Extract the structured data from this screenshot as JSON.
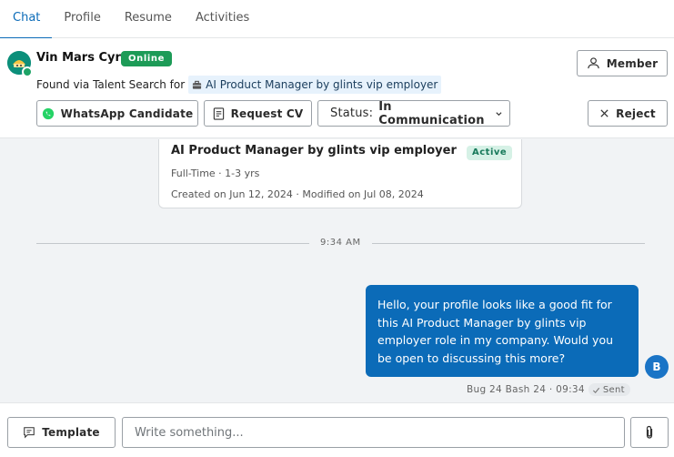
{
  "tabs": [
    {
      "label": "Chat"
    },
    {
      "label": "Profile"
    },
    {
      "label": "Resume"
    },
    {
      "label": "Activities"
    }
  ],
  "candidate": {
    "name": "Vin Mars Cyrr",
    "online_label": "Online",
    "found_via": "Found via Talent Search for",
    "job_title": "AI Product Manager by glints vip employer"
  },
  "actions": {
    "member": "Member",
    "whatsapp": "WhatsApp Candidate",
    "request_cv": "Request CV",
    "status_label": "Status:",
    "status_value": "In Communication",
    "reject": "Reject"
  },
  "job_card": {
    "title": "AI Product Manager by glints vip employer",
    "badge": "Active",
    "meta": "Full-Time · 1-3 yrs",
    "dates": "Created on Jun 12, 2024 · Modified on Jul 08, 2024"
  },
  "chat": {
    "divider_time": "9:34 AM",
    "message": {
      "text": "Hello, your profile looks like a good fit for this AI Product Manager by glints vip employer role in my company. Would you be open to discussing this more?",
      "sender_initial": "B",
      "sender_meta": "Bug 24 Bash 24 · 09:34",
      "status": "Sent"
    }
  },
  "footer": {
    "template": "Template",
    "compose_placeholder": "Write something..."
  },
  "colors": {
    "accent": "#0b6bb8",
    "online": "#1d9b57",
    "active_badge_bg": "#d6f1e6",
    "active_badge_text": "#17795a",
    "chip_bg": "#e7f2fc",
    "chat_bg": "#f1f3f5"
  },
  "icons": {
    "member": "user-icon",
    "whatsapp": "whatsapp-icon",
    "request_cv": "document-icon",
    "status": "chevron-down-icon",
    "reject": "close-icon",
    "template": "message-template-icon",
    "attach": "paperclip-icon",
    "sent": "check-icon",
    "job": "briefcase-icon"
  }
}
